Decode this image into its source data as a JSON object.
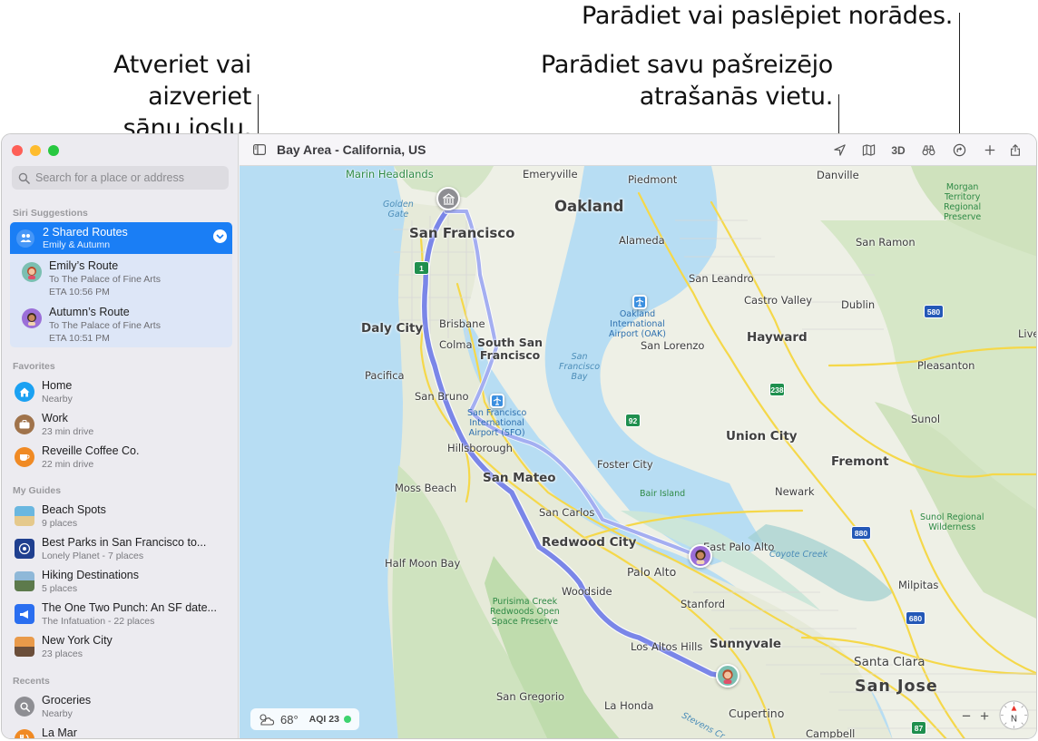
{
  "callouts": {
    "sidebar_line1": "Atveriet vai aizveriet",
    "sidebar_line2": "sānu joslu.",
    "location_line1": "Parādiet savu pašreizējo",
    "location_line2": "atrašanās vietu.",
    "directions": "Parādiet vai paslēpiet norādes."
  },
  "window": {
    "title": "Bay Area - California, US",
    "toolbar": {
      "3d_label": "3D"
    }
  },
  "sidebar": {
    "search_placeholder": "Search for a place or address",
    "siri_header": "Siri Suggestions",
    "shared": {
      "title": "2 Shared Routes",
      "subtitle": "Emily & Autumn",
      "routes": [
        {
          "name": "Emily’s Route",
          "dest": "To The Palace of Fine Arts",
          "eta": "ETA 10:56 PM"
        },
        {
          "name": "Autumn’s Route",
          "dest": "To The Palace of Fine Arts",
          "eta": "ETA 10:51 PM"
        }
      ]
    },
    "favorites_header": "Favorites",
    "favorites": [
      {
        "name": "Home",
        "detail": "Nearby",
        "icon": "house-icon",
        "color": "#1ba1f2"
      },
      {
        "name": "Work",
        "detail": "23 min drive",
        "icon": "briefcase-icon",
        "color": "#a0734b"
      },
      {
        "name": "Reveille Coffee Co.",
        "detail": "22 min drive",
        "icon": "coffee-icon",
        "color": "#f08a24"
      }
    ],
    "guides_header": "My Guides",
    "guides": [
      {
        "name": "Beach Spots",
        "detail": "9 places"
      },
      {
        "name": "Best Parks in San Francisco to...",
        "detail": "Lonely Planet - 7 places"
      },
      {
        "name": "Hiking Destinations",
        "detail": "5 places"
      },
      {
        "name": "The One Two Punch: An SF date...",
        "detail": "The Infatuation - 22 places"
      },
      {
        "name": "New York City",
        "detail": "23 places"
      }
    ],
    "recents_header": "Recents",
    "recents": [
      {
        "name": "Groceries",
        "detail": "Nearby"
      },
      {
        "name": "La Mar",
        "detail": ""
      }
    ]
  },
  "map": {
    "weather": {
      "temp": "68°",
      "aqi": "AQI 23"
    },
    "labels": {
      "sf": "San Francisco",
      "oakland": "Oakland",
      "daly_city": "Daly City",
      "ssf": "South San\nFrancisco",
      "hayward": "Hayward",
      "san_mateo": "San Mateo",
      "redwood": "Redwood City",
      "palo_alto": "Palo Alto",
      "sunnyvale": "Sunnyvale",
      "san_jose": "San Jose",
      "fremont": "Fremont",
      "union_city": "Union City",
      "emeryville": "Emeryville",
      "piedmont": "Piedmont",
      "alameda": "Alameda",
      "san_leandro": "San Leandro",
      "castro_valley": "Castro Valley",
      "dublin": "Dublin",
      "san_ramon": "San Ramon",
      "danville": "Danville",
      "pleasanton": "Pleasanton",
      "sunol": "Sunol",
      "newark": "Newark",
      "milpitas": "Milpitas",
      "santa_clara": "Santa Clara",
      "cupertino": "Cupertino",
      "campbell": "Campbell",
      "los_altos_hills": "Los Altos Hills",
      "stanford": "Stanford",
      "east_palo_alto": "East Palo Alto",
      "woodside": "Woodside",
      "san_carlos": "San Carlos",
      "foster_city": "Foster City",
      "hillsborough": "Hillsborough",
      "san_bruno": "San Bruno",
      "pacifica": "Pacifica",
      "brisbane": "Brisbane",
      "colma": "Colma",
      "moss_beach": "Moss Beach",
      "half_moon_bay": "Half Moon Bay",
      "san_gregorio": "San Gregorio",
      "la_honda": "La Honda",
      "san_lorenzo": "San Lorenzo",
      "marin": "Marin Headlands",
      "golden_gate": "Golden\nGate",
      "sf_bay": "San\nFrancisco\nBay",
      "oak_airport": "Oakland\nInternational\nAirport (OAK)",
      "sfo": "San Francisco\nInternational\nAirport (SFO)",
      "bair": "Bair Island",
      "morgan": "Morgan\nTerritory\nRegional\nPreserve",
      "sunol_park": "Sunol Regional\nWilderness",
      "purisima": "Purisima Creek\nRedwoods Open\nSpace Preserve",
      "coyote": "Coyote Creek",
      "livermore": "Live",
      "stevens": "Stevens Cr"
    },
    "shields": {
      "r1": "1",
      "r92": "92",
      "r238": "238",
      "r580": "580",
      "r880": "880",
      "r680": "680",
      "r87": "87"
    }
  }
}
